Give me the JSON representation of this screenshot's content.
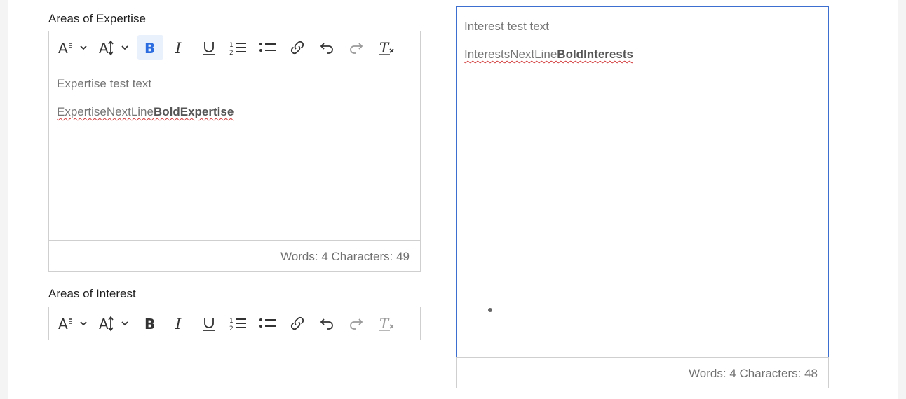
{
  "expertise": {
    "label": "Areas of Expertise",
    "content_line1": "Expertise test text",
    "content_line2_plain": "ExpertiseNextLine",
    "content_line2_bold": "BoldExpertise",
    "footer": "Words: 4 Characters: 49"
  },
  "interest": {
    "label": "Areas of Interest",
    "content_line1": "Interest test text",
    "content_line2_plain": "InterestsNextLine",
    "content_line2_bold": "BoldInterests",
    "footer": "Words: 4 Characters: 48"
  },
  "toolbar_icons": [
    "font-family-icon",
    "font-size-icon",
    "bold-icon",
    "italic-icon",
    "underline-icon",
    "numbered-list-icon",
    "bulleted-list-icon",
    "link-icon",
    "undo-icon",
    "redo-icon",
    "clear-formatting-icon"
  ],
  "colors": {
    "active_bold": "#2b6de0",
    "focus_border": "#3c6fd0",
    "spellcheck": "#d23b3b"
  }
}
